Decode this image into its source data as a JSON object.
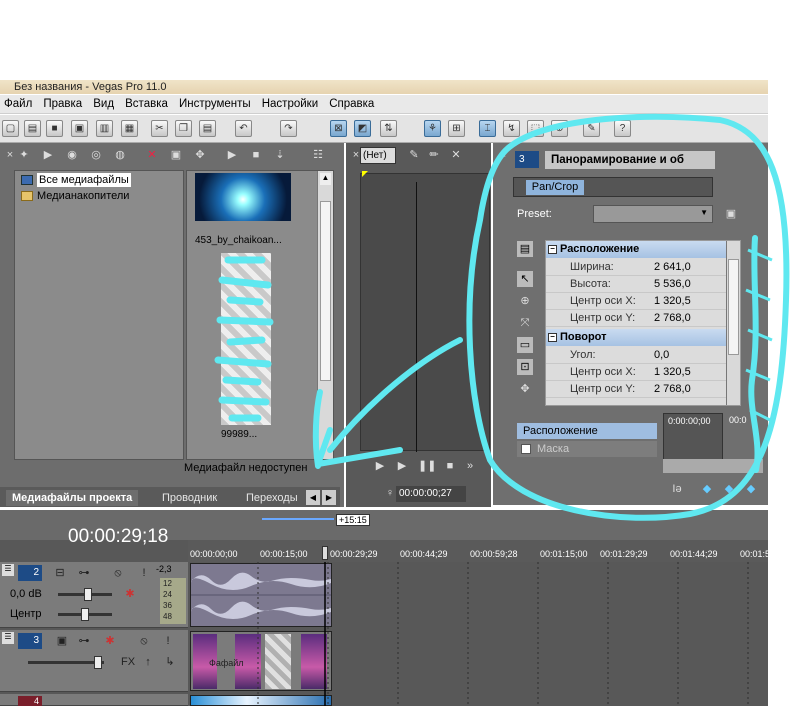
{
  "window": {
    "title": "Без названия - Vegas Pro 11.0"
  },
  "menu": [
    "Файл",
    "Правка",
    "Вид",
    "Вставка",
    "Инструменты",
    "Настройки",
    "Справка"
  ],
  "media_panel": {
    "tree": [
      "Все медиафайлы",
      "Медианакопители"
    ],
    "thumbs": [
      "453_by_chaikoan...",
      "99989..."
    ],
    "status": "Медиафайл недоступен",
    "tabs": [
      "Медиафайлы проекта",
      "Проводник",
      "Переходы"
    ]
  },
  "preview": {
    "combo": "(Нет)",
    "timecode": "00:00:00;27"
  },
  "pan_crop": {
    "track_num": "3",
    "title": "Панорамирование и об",
    "fx_chip": "Pan/Crop",
    "preset_label": "Preset:",
    "categories": [
      {
        "name": "Расположение",
        "rows": [
          {
            "key": "Ширина:",
            "val": "2 641,0"
          },
          {
            "key": "Высота:",
            "val": "5 536,0"
          },
          {
            "key": "Центр оси X:",
            "val": "1 320,5"
          },
          {
            "key": "Центр оси Y:",
            "val": "2 768,0"
          }
        ]
      },
      {
        "name": "Поворот",
        "rows": [
          {
            "key": "Угол:",
            "val": "0,0"
          },
          {
            "key": "Центр оси X:",
            "val": "1 320,5"
          },
          {
            "key": "Центр оси Y:",
            "val": "2 768,0"
          }
        ]
      }
    ],
    "kf_rows": [
      "Расположение",
      "Маска"
    ],
    "kf_time": "0:00:00;00",
    "kf_time2": "00:0"
  },
  "timeline": {
    "current_time": "00:00:29;18",
    "loop_label": "+15:15",
    "ruler": [
      "00:00:00;00",
      "00:00:15;00",
      "00:00:29;29",
      "00:00:44;29",
      "00:00:59;28",
      "00:01:15;00",
      "00:01:29;29",
      "00:01:44;29",
      "00:01:5"
    ],
    "tracks": [
      {
        "num": "2",
        "volume": "0,0 dB",
        "pan": "Центр",
        "meter": [
          "-2,3",
          "12",
          "24",
          "36",
          "48"
        ]
      },
      {
        "num": "3"
      },
      {
        "num": "4"
      }
    ],
    "clip_label": "Фафайл",
    "fx_icon_label": "FX"
  },
  "colors": {
    "accent": "#5fe8f0",
    "selection": "#3a6c98"
  }
}
